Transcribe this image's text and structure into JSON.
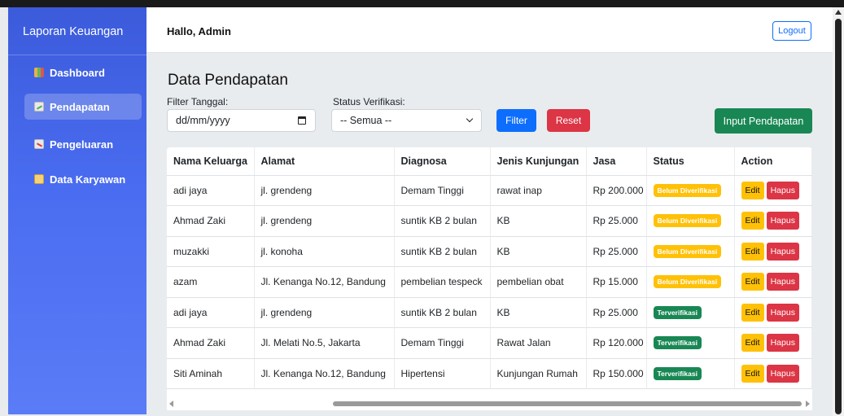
{
  "sidebar": {
    "brand": "Laporan Keuangan",
    "items": [
      {
        "label": "Dashboard",
        "icon": "chart-icon",
        "active": false
      },
      {
        "label": "Pendapatan",
        "icon": "income-chart-icon",
        "active": true
      },
      {
        "label": "Pengeluaran",
        "icon": "expense-chart-icon",
        "active": false
      },
      {
        "label": "Data Karyawan",
        "icon": "employee-data-icon",
        "active": false
      }
    ]
  },
  "topbar": {
    "greeting": "Hallo, Admin",
    "logout_label": "Logout"
  },
  "main": {
    "title": "Data Pendapatan",
    "filter_date_label": "Filter Tanggal:",
    "filter_date_placeholder": "dd/mm/yyyy",
    "status_label": "Status Verifikasi:",
    "status_selected": "-- Semua --",
    "filter_button": "Filter",
    "reset_button": "Reset",
    "input_button": "Input Pendapatan"
  },
  "table": {
    "headers": [
      "Nama Keluarga",
      "Alamat",
      "Diagnosa",
      "Jenis Kunjungan",
      "Jasa",
      "Status",
      "Action"
    ],
    "edit_label": "Edit",
    "delete_label": "Hapus",
    "rows": [
      {
        "nama": "adi jaya",
        "alamat": "jl. grendeng",
        "diagnosa": "Demam Tinggi",
        "jenis": "rawat inap",
        "jasa": "Rp 200.000",
        "status": "Belum Diverifikasi",
        "verified": false
      },
      {
        "nama": "Ahmad Zaki",
        "alamat": "jl. grendeng",
        "diagnosa": "suntik KB 2 bulan",
        "jenis": "KB",
        "jasa": "Rp 25.000",
        "status": "Belum Diverifikasi",
        "verified": false
      },
      {
        "nama": "muzakki",
        "alamat": "jl. konoha",
        "diagnosa": "suntik KB 2 bulan",
        "jenis": "KB",
        "jasa": "Rp 25.000",
        "status": "Belum Diverifikasi",
        "verified": false
      },
      {
        "nama": "azam",
        "alamat": "Jl. Kenanga No.12, Bandung",
        "diagnosa": "pembelian tespeck",
        "jenis": "pembelian obat",
        "jasa": "Rp 15.000",
        "status": "Belum Diverifikasi",
        "verified": false
      },
      {
        "nama": "adi jaya",
        "alamat": "jl. grendeng",
        "diagnosa": "suntik KB 2 bulan",
        "jenis": "KB",
        "jasa": "Rp 25.000",
        "status": "Terverifikasi",
        "verified": true
      },
      {
        "nama": "Ahmad Zaki",
        "alamat": "Jl. Melati No.5, Jakarta",
        "diagnosa": "Demam Tinggi",
        "jenis": "Rawat Jalan",
        "jasa": "Rp 120.000",
        "status": "Terverifikasi",
        "verified": true
      },
      {
        "nama": "Siti Aminah",
        "alamat": "Jl. Kenanga No.12, Bandung",
        "diagnosa": "Hipertensi",
        "jenis": "Kunjungan Rumah",
        "jasa": "Rp 150.000",
        "status": "Terverifikasi",
        "verified": true
      }
    ]
  },
  "colors": {
    "sidebar_top": "#3b5bdb",
    "sidebar_bottom": "#5b7cf7",
    "primary": "#0d6efd",
    "danger": "#dc3545",
    "success": "#198754",
    "warning": "#ffc107"
  }
}
